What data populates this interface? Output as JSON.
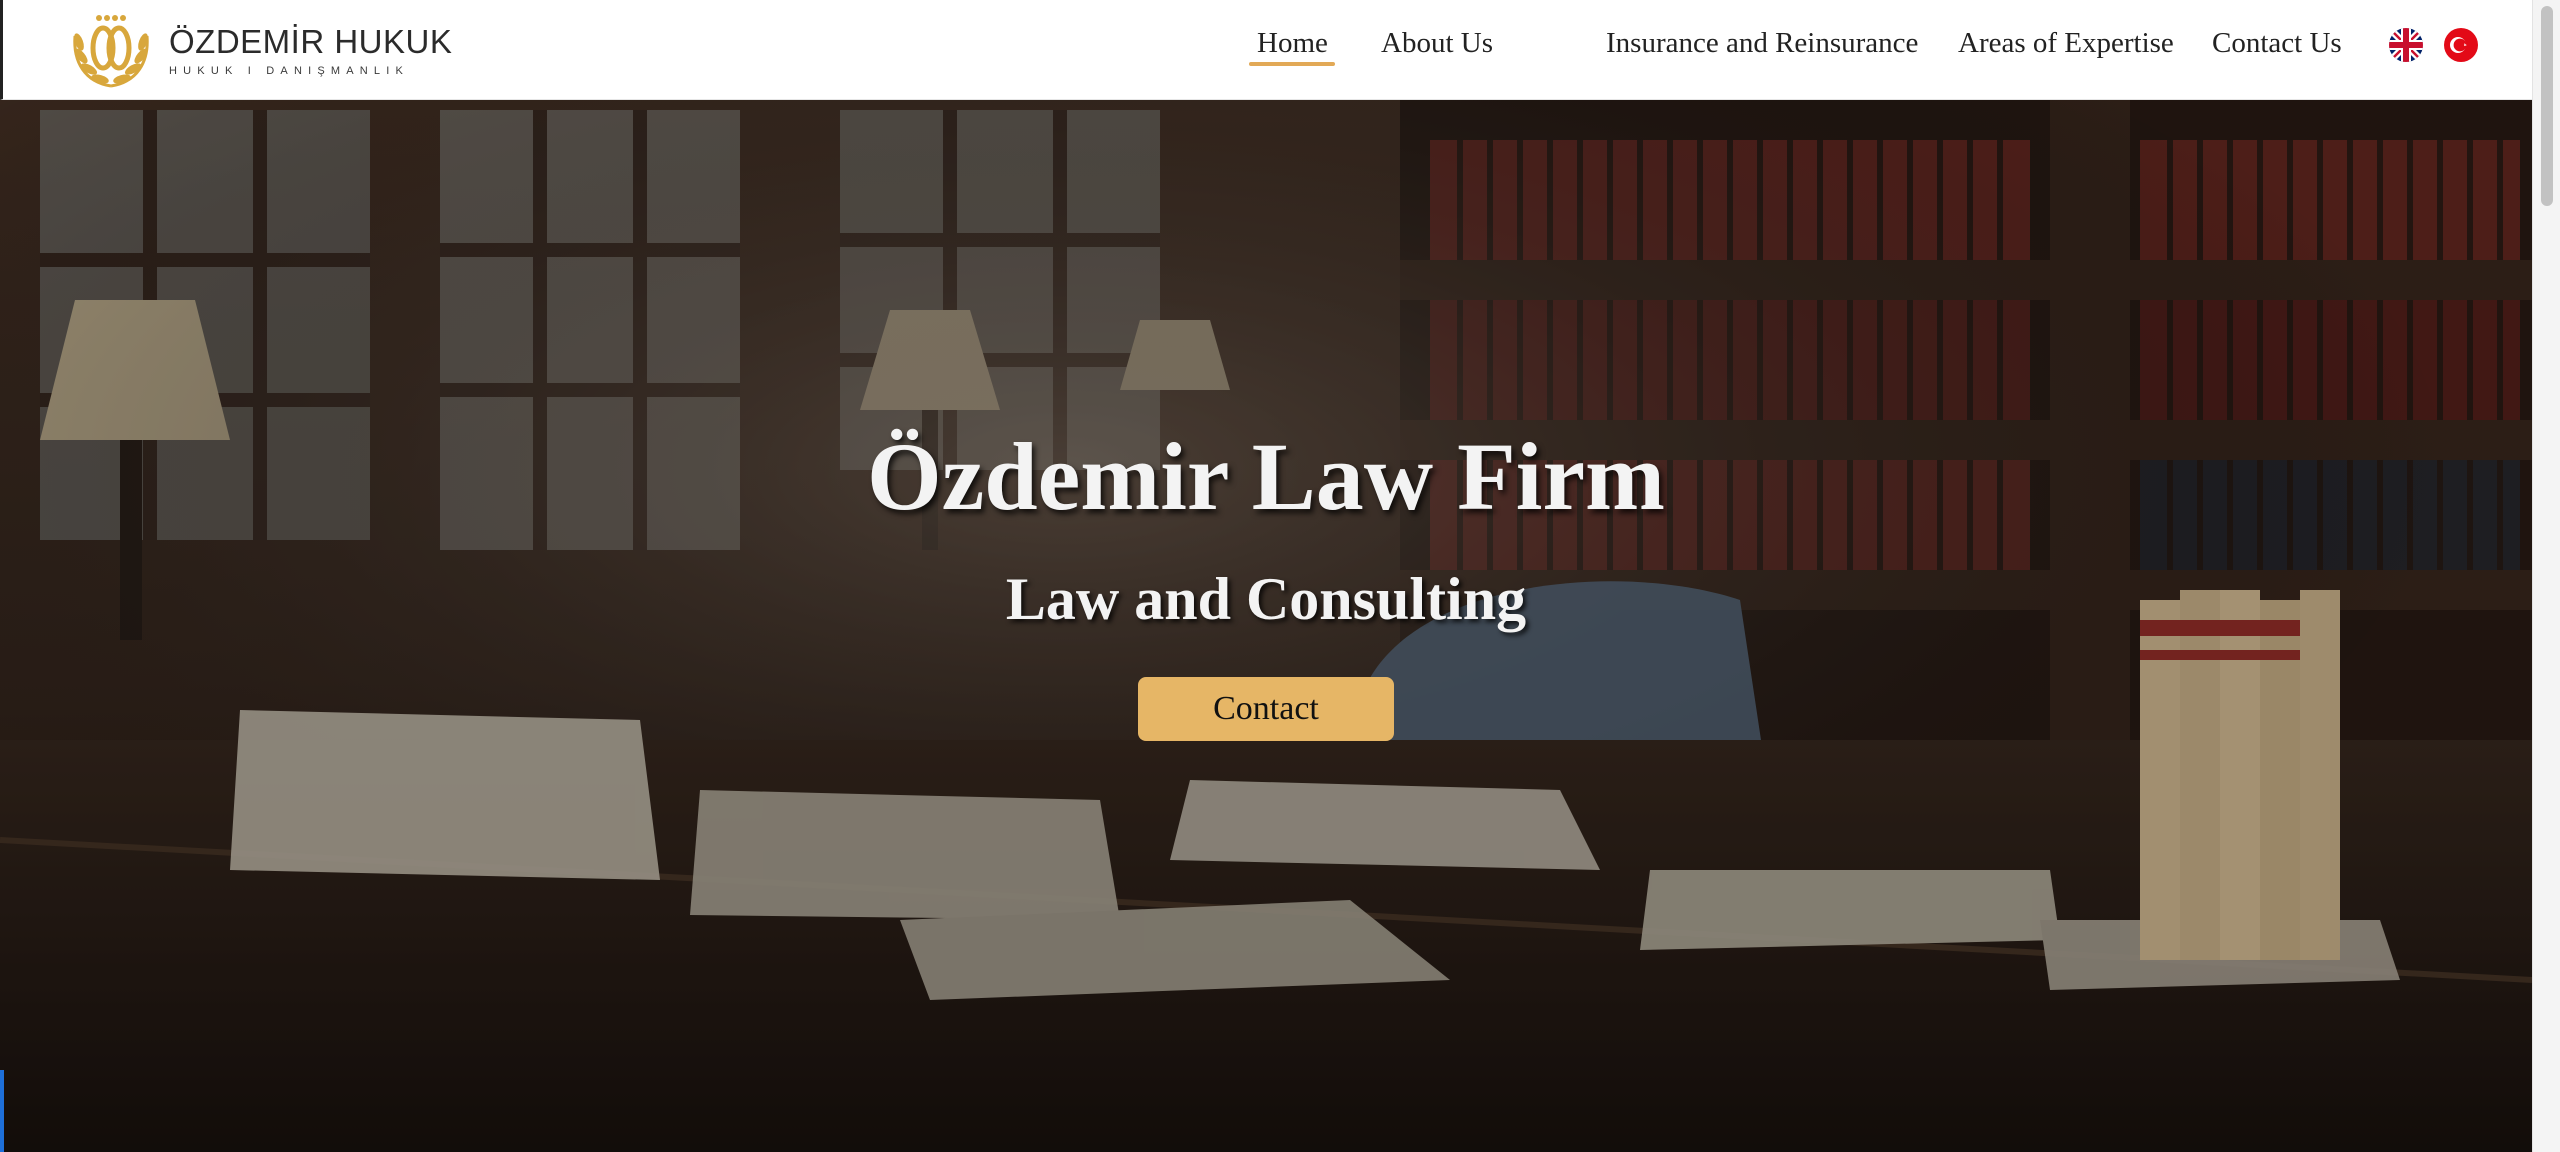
{
  "brand": {
    "name": "ÖZDEMİR HUKUK",
    "tagline": "HUKUK I DANIŞMANLIK",
    "accent_color": "#e2a956"
  },
  "nav": {
    "items": [
      {
        "label": "Home",
        "active": true
      },
      {
        "label": "About Us",
        "active": false
      },
      {
        "label": "Insurance and Reinsurance",
        "active": false
      },
      {
        "label": "Areas of Expertise",
        "active": false
      },
      {
        "label": "Contact Us",
        "active": false
      }
    ],
    "languages": [
      {
        "icon": "uk-flag-icon"
      },
      {
        "icon": "turkey-flag-icon"
      }
    ]
  },
  "hero": {
    "title": "Özdemir Law Firm",
    "subtitle": "Law and Consulting",
    "button_label": "Contact",
    "button_color": "#e6b666"
  }
}
